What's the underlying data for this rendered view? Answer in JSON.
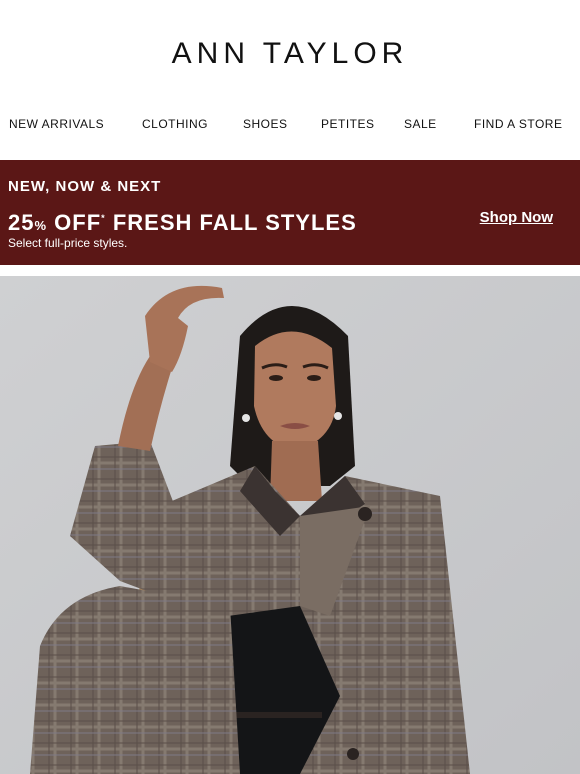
{
  "brand": {
    "logo_text": "ANN TAYLOR"
  },
  "nav": {
    "items": [
      {
        "label": "NEW ARRIVALS"
      },
      {
        "label": "CLOTHING"
      },
      {
        "label": "SHOES"
      },
      {
        "label": "PETITES"
      },
      {
        "label": "SALE"
      },
      {
        "label": "FIND A STORE"
      }
    ]
  },
  "promo": {
    "eyebrow": "NEW, NOW & NEXT",
    "headline_number": "25",
    "headline_percent": "%",
    "headline_off": "OFF",
    "headline_asterisk": "*",
    "headline_rest": "FRESH FALL STYLES",
    "subtext": "Select full-price styles.",
    "cta": "Shop Now",
    "background_color": "#5b1716"
  },
  "hero": {
    "description_icon": "model-photo",
    "background_color": "#c8c9cb"
  }
}
